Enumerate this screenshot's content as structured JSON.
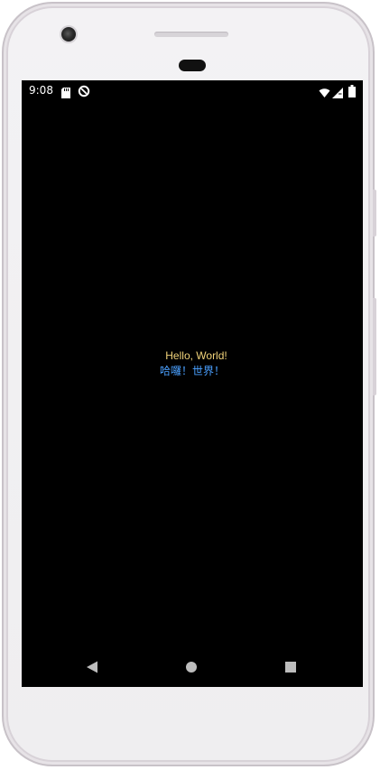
{
  "status_bar": {
    "time": "9:08",
    "icons": [
      "sd-card-icon",
      "sync-icon",
      "wifi-icon",
      "signal-icon",
      "battery-icon"
    ]
  },
  "content": {
    "hello_english": "Hello, World!",
    "hello_chinese": "哈囉！世界！"
  },
  "navigation": {
    "buttons": [
      "back-icon",
      "home-icon",
      "recents-icon"
    ]
  },
  "colors": {
    "screen_background": "#000000",
    "hello_english": "#f2d47a",
    "hello_chinese": "#4aa0ff",
    "status_text": "#ffffff"
  }
}
